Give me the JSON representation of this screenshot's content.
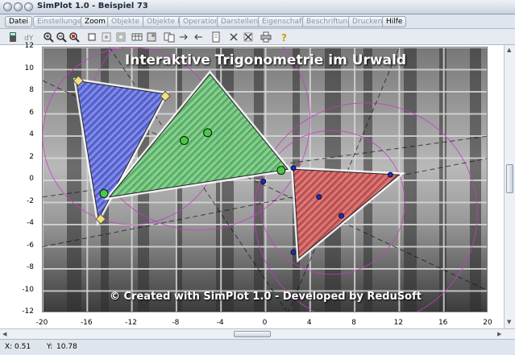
{
  "window": {
    "title": "SimPlot 1.0 - Beispiel 73"
  },
  "menu": {
    "items": [
      {
        "label": "Datei",
        "enabled": true
      },
      {
        "label": "Einstellungen",
        "enabled": false
      },
      {
        "label": "Zoom",
        "enabled": true
      },
      {
        "label": "Objekte I",
        "enabled": false
      },
      {
        "label": "Objekte II",
        "enabled": false
      },
      {
        "label": "Operation",
        "enabled": false
      },
      {
        "label": "Darstellen",
        "enabled": false
      },
      {
        "label": "Eigenschaft",
        "enabled": false
      },
      {
        "label": "Beschriftung",
        "enabled": false
      },
      {
        "label": "Drucken",
        "enabled": false
      },
      {
        "label": "Hilfe",
        "enabled": true
      }
    ]
  },
  "toolbar": {
    "icons": [
      "calculator-icon",
      "function-icon",
      "zoom-in-icon",
      "zoom-out-icon",
      "zoom-fit-icon",
      "square-icon",
      "grid-icon",
      "grid-alt-icon",
      "table-icon",
      "image-icon",
      "copy-icon",
      "arrow-right-icon",
      "arrow-left-icon",
      "page-icon",
      "cross-icon",
      "cross-alt-icon",
      "print-icon",
      "help-icon"
    ]
  },
  "plot": {
    "title": "Interaktive Trigonometrie im Urwald",
    "credit": "© Created with SimPlot 1.0 - Developed by ReduSoft",
    "x_axis": {
      "min": -20,
      "max": 20,
      "ticks": [
        "-20",
        "-16",
        "-12",
        "-8",
        "-4",
        "0",
        "4",
        "8",
        "12",
        "16",
        "20"
      ]
    },
    "y_axis": {
      "min": -12,
      "max": 12,
      "ticks": [
        "12",
        "10",
        "8",
        "6",
        "4",
        "2",
        "0",
        "-2",
        "-4",
        "-6",
        "-8",
        "-10",
        "-12"
      ]
    },
    "colors": {
      "blue_triangle": "#3a4bd6",
      "green_triangle": "#39b04a",
      "red_triangle": "#c42a2a",
      "grid": "#d8d8d8",
      "circles": "#c23ec2"
    }
  },
  "status": {
    "x_label": "X:",
    "x_value": "0.51",
    "y_label": "Y:",
    "y_value": "10.78"
  }
}
